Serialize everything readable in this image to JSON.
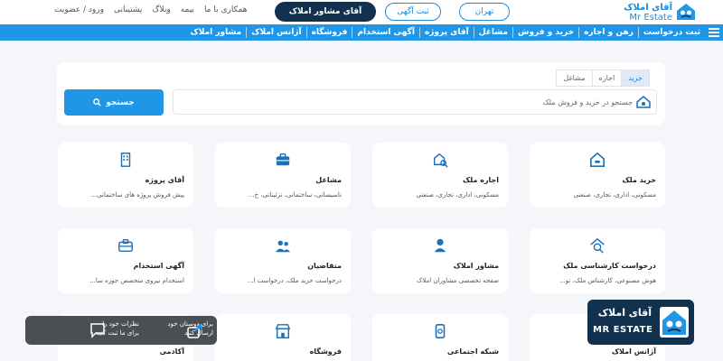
{
  "header": {
    "logo_fa": "آقای املاک",
    "logo_en": "Mr Estate",
    "city_button": "تهران",
    "post_ad_button": "ثبت آگهی",
    "advisor_button": "آقای مشاور املاک",
    "links": [
      "همکاری با ما",
      "بیمه",
      "وبلاگ",
      "پشتیبانی",
      "ورود / عضویت"
    ]
  },
  "nav": {
    "items": [
      "ثبت درخواست",
      "رهن و اجاره",
      "خرید و فروش",
      "مشاغل",
      "آقای پروژه",
      "آگهی استخدام",
      "فروشگاه",
      "آژانس املاک",
      "مشاور املاک"
    ],
    "menu_icon": "hamburger-icon"
  },
  "search": {
    "tabs": [
      "خرید",
      "اجاره",
      "مشاغل"
    ],
    "active_tab": "خرید",
    "placeholder": "جستجو در خرید و فروش ملک",
    "button": "جستجو"
  },
  "cards": [
    {
      "title": "خرید ملک",
      "desc": "مسکونی، اداری، تجاری، صنعتی",
      "icon": "house-icon"
    },
    {
      "title": "اجاره ملک",
      "desc": "مسکونی، اداری، تجاری، صنعتی",
      "icon": "key-house-icon"
    },
    {
      "title": "مشاغل",
      "desc": "تاسیساتی، ساختمانی، تزئیناتی، خ...",
      "icon": "briefcase-icon"
    },
    {
      "title": "آقای پروژه",
      "desc": "پیش فروش پروژه های ساختمانی...",
      "icon": "building-icon"
    },
    {
      "title": "درخواست کارشناسی ملک",
      "desc": "هوش مصنوعی، کارشناس ملک، تو...",
      "icon": "house-search-icon"
    },
    {
      "title": "مشاور املاک",
      "desc": "صفحه تخصصی مشاوران املاک",
      "icon": "person-icon"
    },
    {
      "title": "متقاضیان",
      "desc": "درخواست خرید ملک، درخواست ا...",
      "icon": "users-icon"
    },
    {
      "title": "آگهی استخدام",
      "desc": "استخدام نیروی متخصص حوزه سا...",
      "icon": "briefcase-icon"
    },
    {
      "title": "آژانس املاک",
      "desc": "",
      "icon": "building-icon"
    },
    {
      "title": "شبکه اجتماعی",
      "desc": "",
      "icon": "phone-icon"
    },
    {
      "title": "فروشگاه",
      "desc": "",
      "icon": "store-icon"
    },
    {
      "title": "آکادمی",
      "desc": "",
      "icon": "graduation-icon"
    }
  ],
  "brand_badge": {
    "fa": "آقای املاک",
    "en": "MR ESTATE"
  },
  "feedback": {
    "share_text": "برای دوستان خود ارسال کنید",
    "comment_text": "نظرات خود را برای ما ثبت کنید"
  },
  "colors": {
    "primary": "#2196e6",
    "dark": "#11314f",
    "background": "#f4f6f9"
  }
}
